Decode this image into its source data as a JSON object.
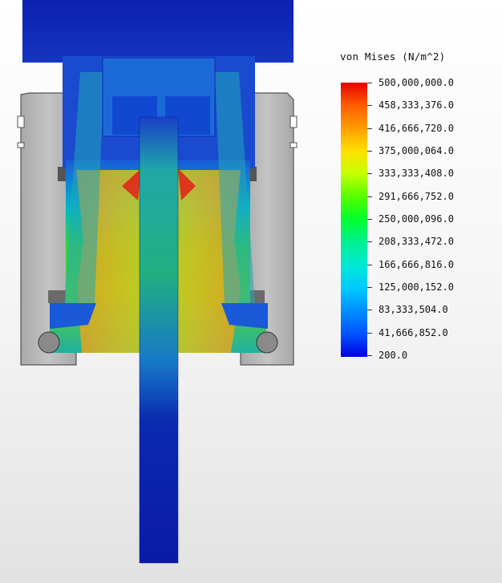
{
  "legend": {
    "title": "von Mises (N/m^2)",
    "labels": [
      "500,000,000.0",
      "458,333,376.0",
      "416,666,720.0",
      "375,000,064.0",
      "333,333,408.0",
      "291,666,752.0",
      "250,000,096.0",
      "208,333,472.0",
      "166,666,816.0",
      "125,000,152.0",
      "83,333,504.0",
      "41,666,852.0",
      "200.0"
    ],
    "colors": {
      "max": "#e60000",
      "mid": "#00ff30",
      "min": "#0000e0"
    }
  }
}
